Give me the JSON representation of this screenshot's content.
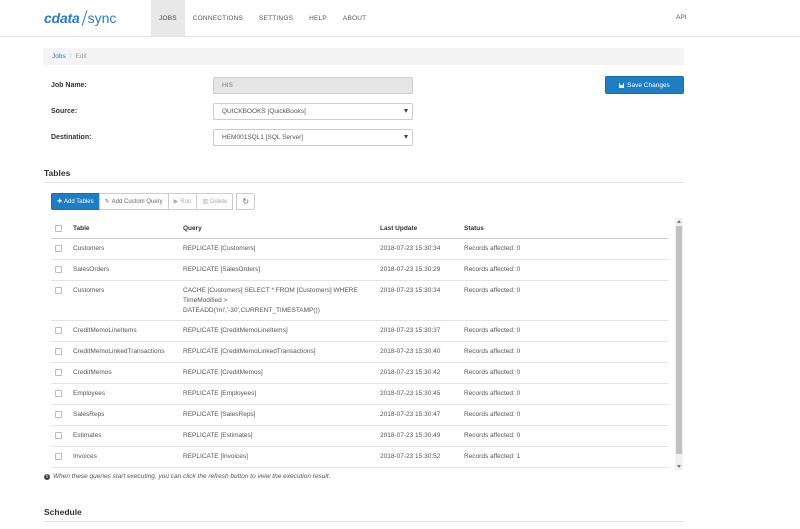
{
  "brand": {
    "part1": "cdata",
    "part2": "sync"
  },
  "nav": {
    "items": [
      {
        "label": "JOBS"
      },
      {
        "label": "CONNECTIONS"
      },
      {
        "label": "SETTINGS"
      },
      {
        "label": "HELP"
      },
      {
        "label": "ABOUT"
      }
    ],
    "active": "JOBS",
    "right_label": "API"
  },
  "breadcrumb": {
    "link": "Jobs",
    "separator": "/",
    "current": "Edit"
  },
  "form": {
    "job_name_label": "Job Name:",
    "job_name_value": "HIS",
    "source_label": "Source:",
    "source_value": "QUICKBOOKS [QuickBooks]",
    "destination_label": "Destination:",
    "destination_value": "HEM001SQL1 [SQL Server]"
  },
  "save_button": {
    "label": "Save Changes",
    "icon": "floppy-disk-icon"
  },
  "tables_section": {
    "title": "Tables"
  },
  "toolbar": {
    "add_tables": "Add Tables",
    "add_custom_query": "Add Custom Query",
    "run": "Run",
    "delete": "Delete",
    "refresh_icon": "refresh-icon"
  },
  "table": {
    "headers": {
      "table": "Table",
      "query": "Query",
      "last_update": "Last Update",
      "status": "Status"
    },
    "rows": [
      {
        "table": "Customers",
        "query": [
          "REPLICATE [Customers]"
        ],
        "last_update": "2018-07-23 15:30:34",
        "status": "Records affected: 0"
      },
      {
        "table": "SalesOrders",
        "query": [
          "REPLICATE [SalesOrders]"
        ],
        "last_update": "2018-07-23 15:30:29",
        "status": "Records affected: 0"
      },
      {
        "table": "Customers",
        "query": [
          "CACHE [Customers] SELECT * FROM [Customers] WHERE",
          "TimeModified >",
          "DATEADD('mi','-30',CURRENT_TIMESTAMP())"
        ],
        "last_update": "2018-07-23 15:30:34",
        "status": "Records affected: 0"
      },
      {
        "table": "CreditMemoLineItems",
        "query": [
          "REPLICATE [CreditMemoLineItems]"
        ],
        "last_update": "2018-07-23 15:30:37",
        "status": "Records affected: 0"
      },
      {
        "table": "CreditMemoLinkedTransactions",
        "query": [
          "REPLICATE [CreditMemoLinkedTransactions]"
        ],
        "last_update": "2018-07-23 15:30:40",
        "status": "Records affected: 0"
      },
      {
        "table": "CreditMemos",
        "query": [
          "REPLICATE [CreditMemos]"
        ],
        "last_update": "2018-07-23 15:30:42",
        "status": "Records affected: 0"
      },
      {
        "table": "Employees",
        "query": [
          "REPLICATE [Employees]"
        ],
        "last_update": "2018-07-23 15:30:45",
        "status": "Records affected: 0"
      },
      {
        "table": "SalesReps",
        "query": [
          "REPLICATE [SalesReps]"
        ],
        "last_update": "2018-07-23 15:30:47",
        "status": "Records affected: 0"
      },
      {
        "table": "Estimates",
        "query": [
          "REPLICATE [Estimates]"
        ],
        "last_update": "2018-07-23 15:30:49",
        "status": "Records affected: 0"
      },
      {
        "table": "Invoices",
        "query": [
          "REPLICATE [Invoices]"
        ],
        "last_update": "2018-07-23 15:30:52",
        "status": "Records affected: 1"
      }
    ]
  },
  "note": "When these queries start executing, you can click the refresh button to view the execution result.",
  "schedule_section": {
    "title": "Schedule"
  },
  "colors": {
    "primary": "#1e7ec1",
    "brand": "#2a7dbf",
    "nav_active_bg": "#e8e8e8"
  }
}
